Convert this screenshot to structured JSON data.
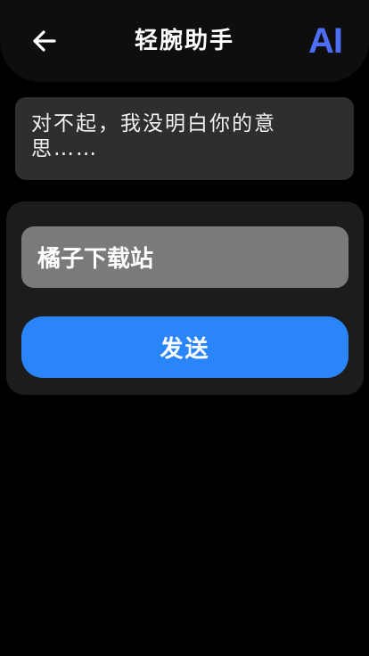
{
  "header": {
    "title": "轻腕助手",
    "ai_label": "AI",
    "back_icon": "arrow-left-icon"
  },
  "conversation": {
    "reply": "对不起，我没明白你的意思……"
  },
  "composer": {
    "input_value": "橘子下载站",
    "send_label": "发送"
  },
  "colors": {
    "background": "#000000",
    "header_bg": "#0e0e0e",
    "bubble_bg": "#2e2e2e",
    "panel_bg": "#1c1c1c",
    "input_bg": "#7a7a7a",
    "accent": "#2a86f8",
    "ai_badge": "#4f6ef7"
  }
}
